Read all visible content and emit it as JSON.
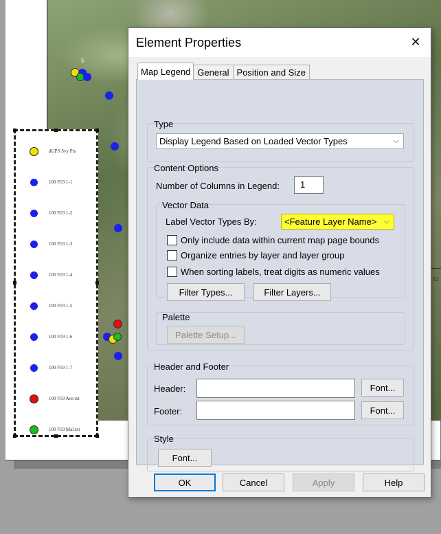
{
  "dialog": {
    "title": "Element Properties",
    "close_glyph": "✕",
    "tabs": [
      {
        "label": "Map Legend"
      },
      {
        "label": "General"
      },
      {
        "label": "Position and Size"
      }
    ],
    "type_group": {
      "title": "Type",
      "selected": "Display Legend Based on Loaded Vector Types"
    },
    "content_options": {
      "title": "Content Options",
      "columns_label": "Number of Columns in Legend:",
      "columns_value": "1",
      "vector_data": {
        "title": "Vector Data",
        "label_by_label": "Label Vector Types By:",
        "label_by_value": "<Feature Layer Name>",
        "checkboxes": [
          {
            "label": "Only include data within current map page bounds",
            "checked": false
          },
          {
            "label": "Organize entries by layer and layer group",
            "checked": false
          },
          {
            "label": "When sorting labels, treat digits as numeric values",
            "checked": false
          }
        ],
        "filter_types_label": "Filter Types...",
        "filter_layers_label": "Filter Layers..."
      },
      "palette": {
        "title": "Palette",
        "setup_label": "Palette Setup..."
      }
    },
    "header_footer": {
      "title": "Header and Footer",
      "header_label": "Header:",
      "header_value": "",
      "footer_label": "Footer:",
      "footer_value": "",
      "font_label": "Font..."
    },
    "style": {
      "title": "Style",
      "font_label": "Font..."
    },
    "buttons": {
      "ok": "OK",
      "cancel": "Cancel",
      "apply": "Apply",
      "help": "Help"
    }
  },
  "map": {
    "point_label": "5",
    "edge_number": "41"
  },
  "legend": {
    "items": [
      {
        "label": "dGPS Svy Pts",
        "symbol": "yellow-circle",
        "color": "#f4e000"
      },
      {
        "label": "100 F19 1-1",
        "symbol": "blue-dot",
        "color": "#1a22e8"
      },
      {
        "label": "100 F19 1-2",
        "symbol": "blue-dot",
        "color": "#1a22e8"
      },
      {
        "label": "100 F19 1-3",
        "symbol": "blue-dot",
        "color": "#1a22e8"
      },
      {
        "label": "100 F19 1-4",
        "symbol": "blue-dot",
        "color": "#1a22e8"
      },
      {
        "label": "100 F19 1-5",
        "symbol": "blue-dot",
        "color": "#1a22e8"
      },
      {
        "label": "100 F19 1-6",
        "symbol": "blue-dot",
        "color": "#1a22e8"
      },
      {
        "label": "100 F19 1-7",
        "symbol": "blue-dot",
        "color": "#1a22e8"
      },
      {
        "label": "100 F19 Ave.txt",
        "symbol": "red-circle",
        "color": "#e21010"
      },
      {
        "label": "100 F19 Mal.txt",
        "symbol": "green-circle",
        "color": "#18c020"
      }
    ]
  },
  "colors": {
    "highlight": "#ffff33",
    "panel": "#d7dce6",
    "accent": "#0078d7"
  }
}
